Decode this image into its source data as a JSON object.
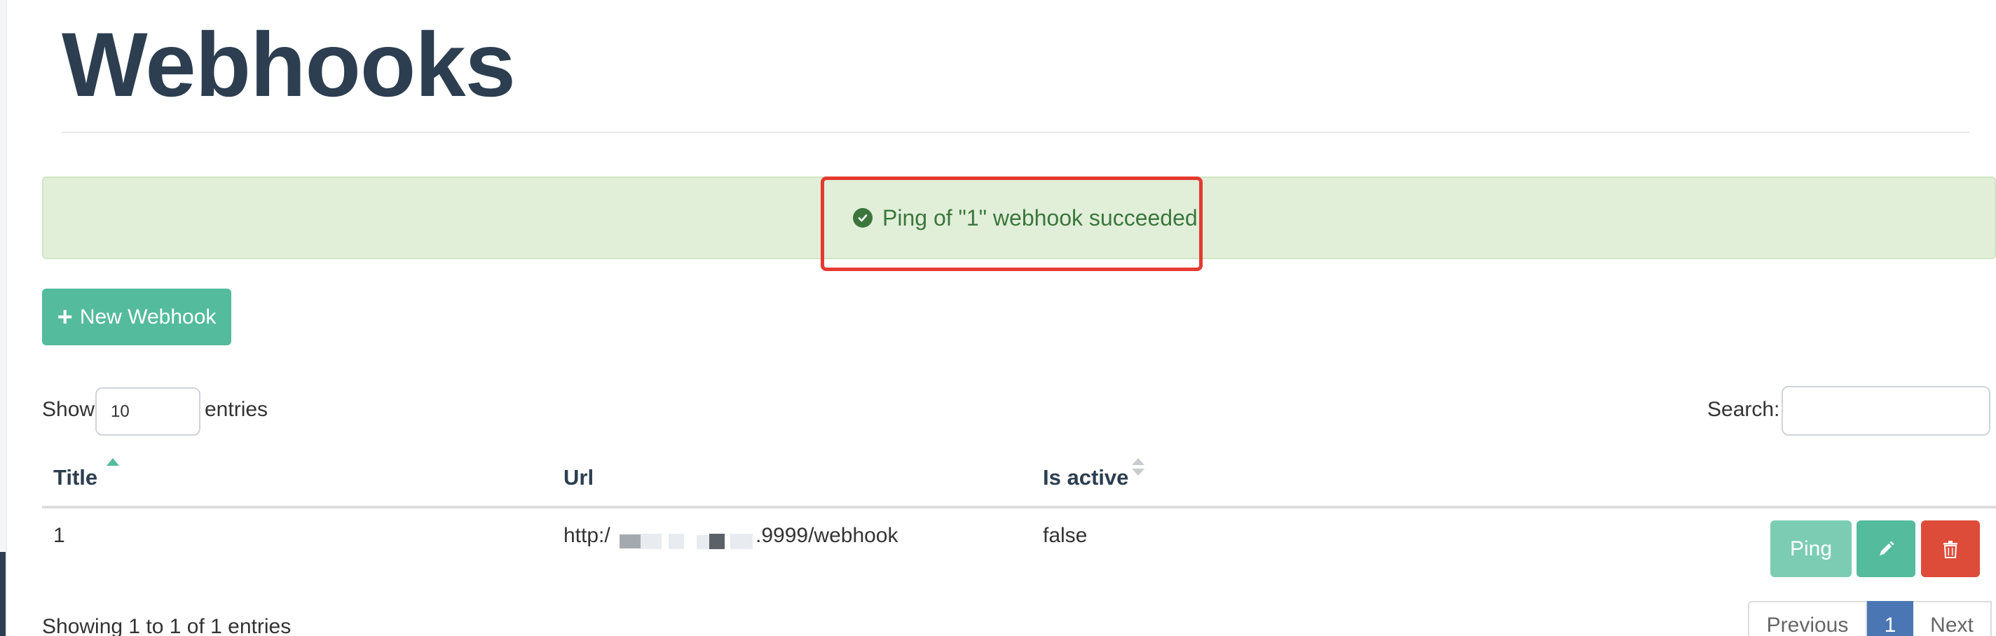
{
  "page": {
    "title": "Webhooks"
  },
  "alert": {
    "message": "Ping of \"1\" webhook succeeded.",
    "icon": "check-circle-icon",
    "color": "#3c763d",
    "background": "#e1efd9"
  },
  "toolbar": {
    "new_label": "New Webhook"
  },
  "table_controls": {
    "show_label": "Show",
    "page_size": "10",
    "entries_label": "entries",
    "search_label": "Search:",
    "search_value": ""
  },
  "table": {
    "columns": [
      {
        "label": "Title",
        "sort": "ascending"
      },
      {
        "label": "Url",
        "sort": "none"
      },
      {
        "label": "Is active",
        "sort": "sortable"
      }
    ],
    "rows": [
      {
        "title": "1",
        "url_prefix": "http:/",
        "url_suffix": ".9999/webhook",
        "is_active": "false",
        "actions": {
          "ping_label": "Ping",
          "edit_icon": "pencil-icon",
          "delete_icon": "trash-icon"
        }
      }
    ]
  },
  "footer": {
    "info": "Showing 1 to 1 of 1 entries",
    "pagination": {
      "previous": "Previous",
      "current": "1",
      "next": "Next"
    }
  },
  "colors": {
    "primary": "#54bb9c",
    "danger": "#dd4b39",
    "heading": "#2c3e50",
    "page_active": "#4a77b4",
    "highlight": "#e53a30"
  }
}
